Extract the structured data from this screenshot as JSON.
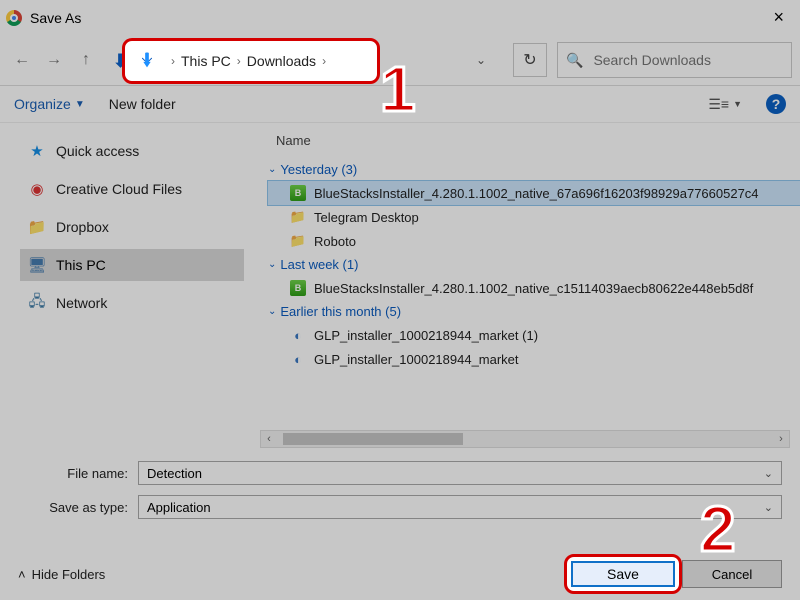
{
  "window": {
    "title": "Save As"
  },
  "breadcrumb": {
    "items": [
      "This PC",
      "Downloads"
    ]
  },
  "search": {
    "placeholder": "Search Downloads"
  },
  "toolbar": {
    "organize": "Organize",
    "new_folder": "New folder"
  },
  "sidebar": {
    "items": [
      {
        "label": "Quick access",
        "icon": "star"
      },
      {
        "label": "Creative Cloud Files",
        "icon": "cc"
      },
      {
        "label": "Dropbox",
        "icon": "folder"
      },
      {
        "label": "This PC",
        "icon": "pc",
        "selected": true
      },
      {
        "label": "Network",
        "icon": "net"
      }
    ]
  },
  "file_list": {
    "column_header": "Name",
    "groups": [
      {
        "label": "Yesterday (3)",
        "items": [
          {
            "name": "BlueStacksInstaller_4.280.1.1002_native_67a696f16203f98929a77660527c4",
            "icon": "bs",
            "selected": true
          },
          {
            "name": "Telegram Desktop",
            "icon": "fld"
          },
          {
            "name": "Roboto",
            "icon": "fld"
          }
        ]
      },
      {
        "label": "Last week (1)",
        "items": [
          {
            "name": "BlueStacksInstaller_4.280.1.1002_native_c15114039aecb80622e448eb5d8f",
            "icon": "bs"
          }
        ]
      },
      {
        "label": "Earlier this month (5)",
        "items": [
          {
            "name": "GLP_installer_1000218944_market (1)",
            "icon": "glp"
          },
          {
            "name": "GLP_installer_1000218944_market",
            "icon": "glp"
          }
        ]
      }
    ]
  },
  "form": {
    "file_name_label": "File name:",
    "file_name_value": "Detection",
    "type_label": "Save as type:",
    "type_value": "Application"
  },
  "footer": {
    "hide_folders": "Hide Folders",
    "save": "Save",
    "cancel": "Cancel"
  },
  "callouts": {
    "one": "1",
    "two": "2"
  }
}
